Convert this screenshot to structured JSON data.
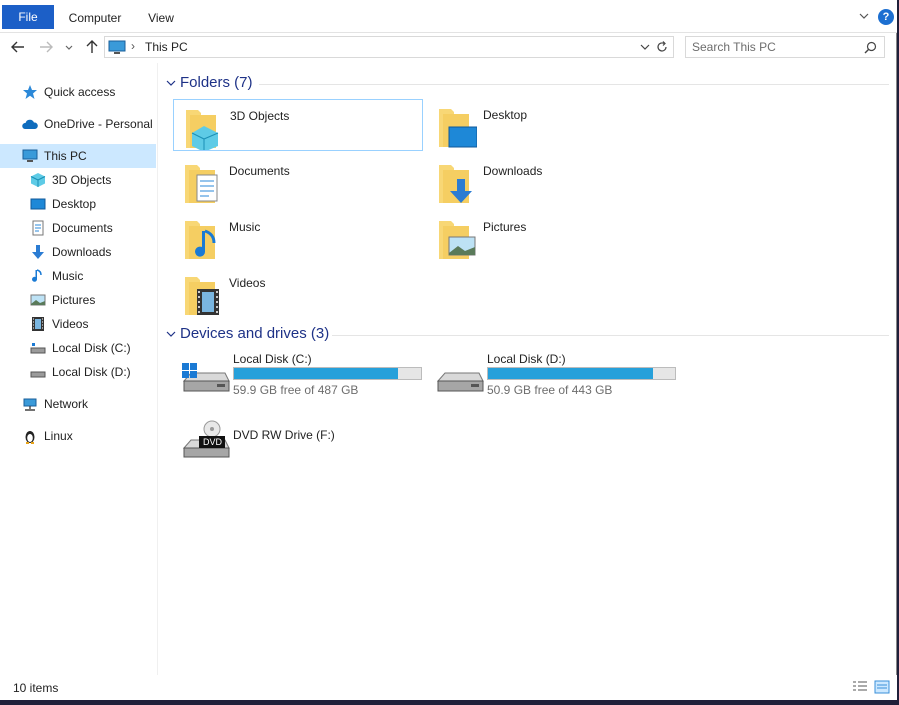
{
  "ribbon": {
    "file": "File",
    "computer": "Computer",
    "view": "View",
    "help": "?"
  },
  "nav": {
    "address_sep": "›",
    "address": "This PC",
    "search_placeholder": "Search This PC"
  },
  "sidebar": {
    "items": [
      {
        "label": "Quick access",
        "icon": "star-icon"
      },
      {
        "label": "OneDrive - Personal",
        "icon": "cloud-icon"
      },
      {
        "label": "This PC",
        "icon": "computer-icon"
      },
      {
        "label": "3D Objects",
        "icon": "cube-icon"
      },
      {
        "label": "Desktop",
        "icon": "desktop-icon"
      },
      {
        "label": "Documents",
        "icon": "document-icon"
      },
      {
        "label": "Downloads",
        "icon": "download-icon"
      },
      {
        "label": "Music",
        "icon": "music-icon"
      },
      {
        "label": "Pictures",
        "icon": "picture-icon"
      },
      {
        "label": "Videos",
        "icon": "video-icon"
      },
      {
        "label": "Local Disk (C:)",
        "icon": "drive-icon"
      },
      {
        "label": "Local Disk (D:)",
        "icon": "drive-icon"
      },
      {
        "label": "Network",
        "icon": "network-icon"
      },
      {
        "label": "Linux",
        "icon": "linux-icon"
      }
    ]
  },
  "folders": {
    "header": "Folders (7)",
    "items": [
      {
        "label": "3D Objects"
      },
      {
        "label": "Desktop"
      },
      {
        "label": "Documents"
      },
      {
        "label": "Downloads"
      },
      {
        "label": "Music"
      },
      {
        "label": "Pictures"
      },
      {
        "label": "Videos"
      }
    ]
  },
  "drives": {
    "header": "Devices and drives (3)",
    "items": [
      {
        "label": "Local Disk (C:)",
        "free": "59.9 GB free of 487 GB",
        "used_fraction": 0.877
      },
      {
        "label": "Local Disk (D:)",
        "free": "50.9 GB free of 443 GB",
        "used_fraction": 0.885
      },
      {
        "label": "DVD RW Drive (F:)",
        "badge": "DVD"
      }
    ]
  },
  "status": {
    "items": "10 items"
  },
  "colors": {
    "accent": "#1c5fc7",
    "selection": "#cce8ff",
    "bar_fill": "#26a0da",
    "group_header": "#1e3287",
    "folder": "#f8d775"
  }
}
